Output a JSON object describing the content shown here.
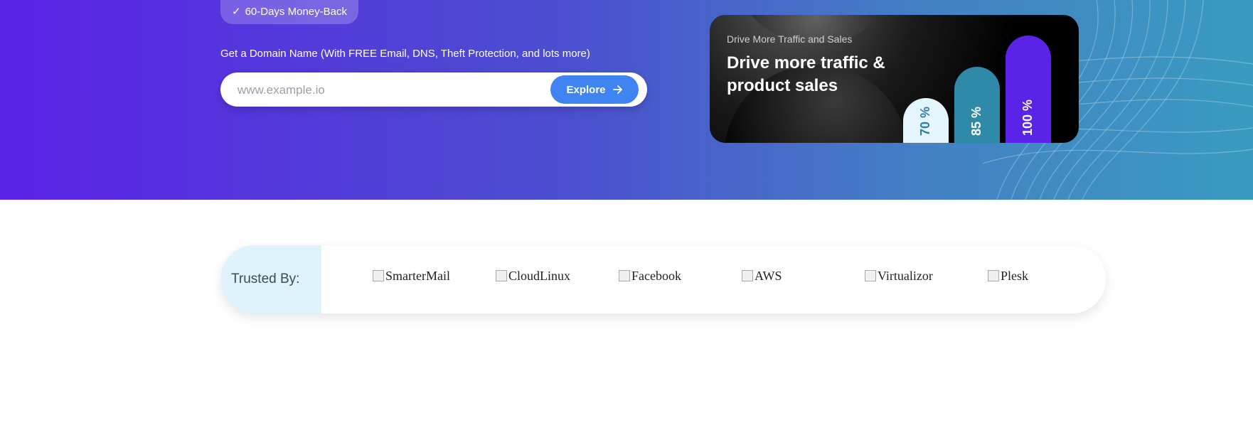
{
  "hero": {
    "badge": {
      "check": "✓",
      "text": "60-Days Money-Back"
    },
    "domain_label": "Get a Domain Name (With FREE Email, DNS, Theft Protection, and lots more)",
    "search": {
      "placeholder": "www.example.io",
      "value": ""
    },
    "explore_label": "Explore"
  },
  "card": {
    "subtitle": "Drive More Traffic and Sales",
    "title": "Drive more traffic & product sales"
  },
  "chart_data": {
    "type": "bar",
    "categories": [
      "70 %",
      "85 %",
      "100 %"
    ],
    "values": [
      70,
      85,
      100
    ],
    "colors": [
      "#e4f5fd",
      "#2e8aa8",
      "#5b22e8"
    ]
  },
  "trusted": {
    "label": "Trusted By:",
    "logos": [
      "SmarterMail",
      "CloudLinux",
      "Facebook",
      "AWS",
      "Virtualizor",
      "Plesk"
    ]
  },
  "colors": {
    "accent": "#3f84f0",
    "brand_purple": "#5b22e8",
    "teal": "#2e8aa8"
  }
}
